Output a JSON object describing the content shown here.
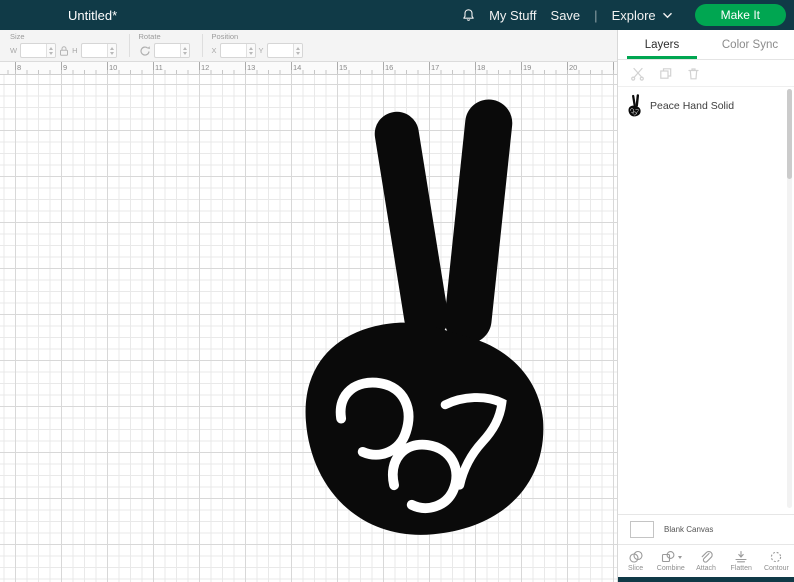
{
  "colors": {
    "topbar-bg": "#103a47",
    "accent-green": "#00a651",
    "grid-minor": "#e9e9e9",
    "grid-major": "#d8d8d8",
    "shape-color": "#0a0a0a"
  },
  "icons": [
    "bell-icon",
    "chevron-down-icon",
    "lock-aspect-icon",
    "rotate-icon",
    "stepper-arrows",
    "scissors-icon",
    "duplicate-icon",
    "trash-icon",
    "slice-icon",
    "combine-icon",
    "attach-icon",
    "flatten-icon",
    "contour-icon",
    "peace-hand-shape"
  ],
  "top_bar": {
    "title": "Untitled*",
    "nav": {
      "my_stuff": "My Stuff",
      "save": "Save",
      "separator": "|",
      "explore": "Explore",
      "make_it": "Make It"
    }
  },
  "edit_toolbar": {
    "size": {
      "label": "Size",
      "w_label": "W",
      "w_value": "",
      "h_label": "H",
      "h_value": ""
    },
    "rotate": {
      "label": "Rotate",
      "value": ""
    },
    "position": {
      "label": "Position",
      "x_label": "X",
      "x_value": "",
      "y_label": "Y",
      "y_value": ""
    }
  },
  "ruler": {
    "ticks": [
      "8",
      "9",
      "10",
      "11",
      "12",
      "13",
      "14",
      "15",
      "16",
      "17",
      "18",
      "19",
      "20"
    ]
  },
  "canvas": {
    "shape_name": "Peace Hand Solid"
  },
  "layers_panel": {
    "tabs": {
      "layers": "Layers",
      "color_sync": "Color Sync"
    },
    "layer_items": [
      {
        "name": "Peace Hand Solid"
      }
    ],
    "blank_canvas_label": "Blank Canvas",
    "tools": [
      {
        "label": "Slice"
      },
      {
        "label": "Combine"
      },
      {
        "label": "Attach"
      },
      {
        "label": "Flatten"
      },
      {
        "label": "Contour"
      }
    ]
  }
}
